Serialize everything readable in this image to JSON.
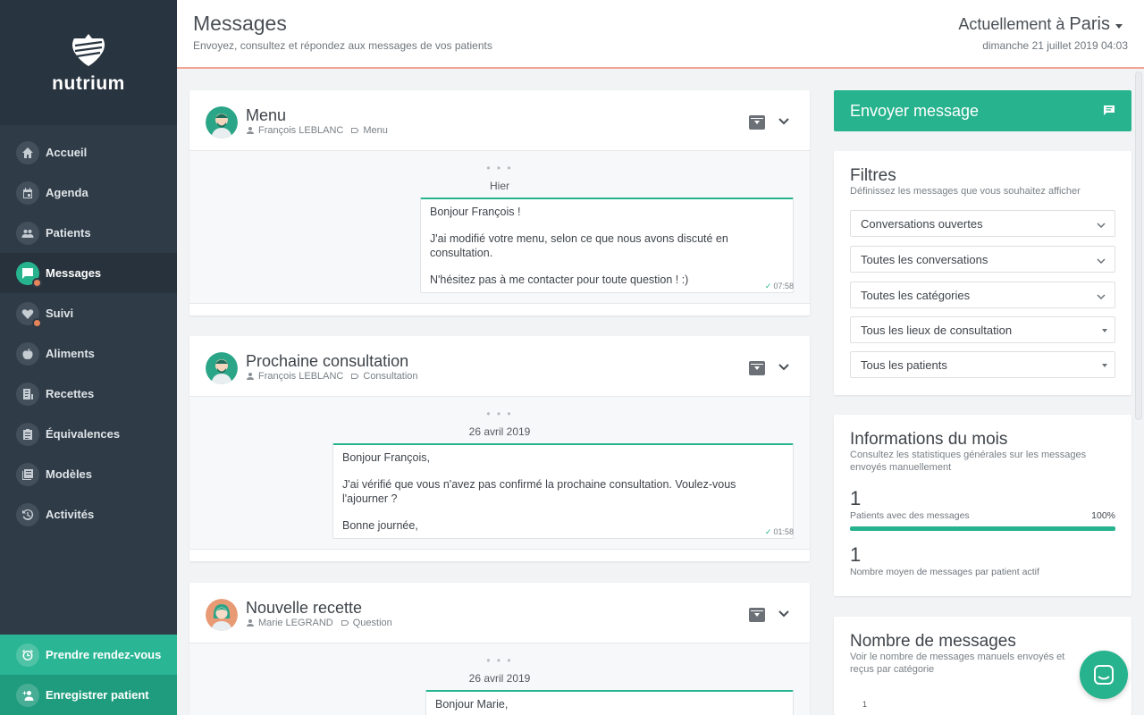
{
  "brand": {
    "name": "nutrium"
  },
  "sidebar": {
    "items": [
      {
        "label": "Accueil"
      },
      {
        "label": "Agenda"
      },
      {
        "label": "Patients"
      },
      {
        "label": "Messages"
      },
      {
        "label": "Suivi"
      },
      {
        "label": "Aliments"
      },
      {
        "label": "Recettes"
      },
      {
        "label": "Équivalences"
      },
      {
        "label": "Modèles"
      },
      {
        "label": "Activités"
      }
    ],
    "book_appointment": "Prendre rendez-vous",
    "register_patient": "Enregistrer patient"
  },
  "header": {
    "title": "Messages",
    "subtitle": "Envoyez, consultez et répondez aux messages de vos patients",
    "location_prefix": "Actuellement à",
    "location_city": "Paris",
    "datetime": "dimanche 21 juillet 2019 04:03"
  },
  "conversations": [
    {
      "title": "Menu",
      "patient": "François LEBLANC",
      "category": "Menu",
      "dots": "• • •",
      "day": "Hier",
      "message": [
        "Bonjour François !",
        "J'ai modifié votre menu, selon ce que nous avons discuté en consultation.",
        "N'hésitez pas à me contacter pour toute question ! :)"
      ],
      "time": "07:58"
    },
    {
      "title": "Prochaine consultation",
      "patient": "François LEBLANC",
      "category": "Consultation",
      "dots": "• • •",
      "day": "26 avril 2019",
      "message": [
        "Bonjour François,",
        "J'ai vérifié que vous n'avez pas confirmé la prochaine consultation. Voulez-vous l'ajourner ?",
        "Bonne journée,"
      ],
      "time": "01:58"
    },
    {
      "title": "Nouvelle recette",
      "patient": "Marie LEGRAND",
      "category": "Question",
      "dots": "• • •",
      "day": "26 avril 2019",
      "message": [
        "Bonjour Marie,"
      ]
    }
  ],
  "send_message": {
    "label": "Envoyer message"
  },
  "filters": {
    "title": "Filtres",
    "subtitle": "Définissez les messages que vous souhaitez afficher",
    "selects": [
      "Conversations ouvertes",
      "Toutes les conversations",
      "Toutes les catégories",
      "Tous les lieux de consultation",
      "Tous les patients"
    ]
  },
  "month_info": {
    "title": "Informations du mois",
    "subtitle": "Consultez les statistiques générales sur les messages envoyés manuellement",
    "patients_count": "1",
    "patients_label": "Patients avec des messages",
    "patients_pct": "100%",
    "patients_fraction": 1.0,
    "avg_count": "1",
    "avg_label": "Nombre moyen de messages par patient actif"
  },
  "messages_count": {
    "title": "Nombre de messages",
    "subtitle": "Voir le nombre de messages manuels envoyés et reçus par catégorie",
    "tick": "1"
  },
  "colors": {
    "accent": "#26b38d",
    "sidebar": "#2f3b46",
    "badge": "#e5845b"
  }
}
